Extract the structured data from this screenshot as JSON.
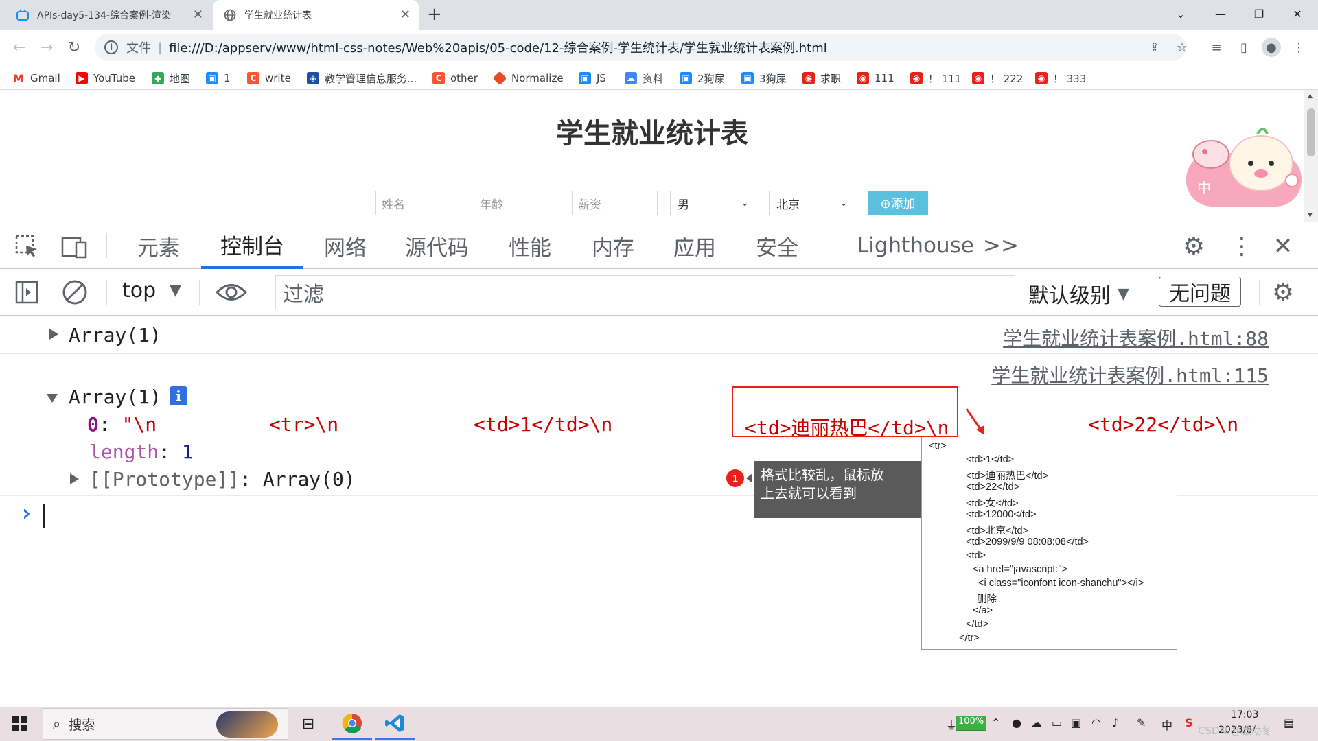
{
  "browser": {
    "tabs": [
      {
        "title": "APIs-day5-134-综合案例-渲染",
        "active": false
      },
      {
        "title": "学生就业统计表",
        "active": true
      }
    ],
    "new_tab": "+",
    "omnibox": {
      "scheme_label": "文件",
      "separator": "|",
      "url": "file:///D:/appserv/www/html-css-notes/Web%20apis/05-code/12-综合案例-学生统计表/学生就业统计表案例.html"
    },
    "bookmarks": [
      {
        "label": "Gmail",
        "icon": "gmail-icon",
        "color": "#ea4335"
      },
      {
        "label": "YouTube",
        "icon": "youtube-icon",
        "color": "#ff0000"
      },
      {
        "label": "地图",
        "icon": "maps-icon",
        "color": "#34a853"
      },
      {
        "label": "1",
        "icon": "bilibili-icon",
        "color": "#1a8cff"
      },
      {
        "label": "write",
        "icon": "csdn-icon",
        "color": "#fc5531"
      },
      {
        "label": "教学管理信息服务...",
        "icon": "school-icon",
        "color": "#1e50a2"
      },
      {
        "label": "other",
        "icon": "csdn-icon",
        "color": "#fc5531"
      },
      {
        "label": "Normalize",
        "icon": "diamond-icon",
        "color": "#e34c26"
      },
      {
        "label": "JS",
        "icon": "bilibili-icon",
        "color": "#1a8cff"
      },
      {
        "label": "资料",
        "icon": "cloud-icon",
        "color": "#4285f4"
      },
      {
        "label": "2狗屎",
        "icon": "bilibili-icon",
        "color": "#1a8cff"
      },
      {
        "label": "3狗屎",
        "icon": "bilibili-icon",
        "color": "#1a8cff"
      },
      {
        "label": "求职",
        "icon": "red-app-icon",
        "color": "#e8211b"
      },
      {
        "label": "111",
        "icon": "red-app-icon",
        "color": "#e8211b"
      },
      {
        "label": "！ 111",
        "icon": "red-app-icon",
        "color": "#e8211b"
      },
      {
        "label": "！ 222",
        "icon": "red-app-icon",
        "color": "#e8211b"
      },
      {
        "label": "！ 333",
        "icon": "red-app-icon",
        "color": "#e8211b"
      }
    ]
  },
  "page": {
    "title": "学生就业统计表",
    "name_placeholder": "姓名",
    "age_placeholder": "年龄",
    "salary_placeholder": "薪资",
    "gender_value": "男",
    "city_value": "北京",
    "add_button": "⊕添加",
    "sticker_text": "中"
  },
  "devtools": {
    "tabs": [
      "元素",
      "控制台",
      "网络",
      "源代码",
      "性能",
      "内存",
      "应用",
      "安全",
      "Lighthouse"
    ],
    "active_tab": "控制台",
    "more_tabs": ">>",
    "context": "top",
    "filter_placeholder": "过滤",
    "level": "默认级别",
    "issues": "无问题",
    "console": {
      "msg1": {
        "text": "Array(1)",
        "source": "学生就业统计表案例.html:88"
      },
      "msg2": {
        "source": "学生就业统计表案例.html:115",
        "text": "Array(1)",
        "info_badge": "i",
        "item0_key": "0",
        "item0_colon": ": ",
        "item0_quote": "\"\\n",
        "tr_open": "<tr>\\n",
        "td1": "<td>1</td>\\n",
        "td_name": "<td>迪丽热巴</td>\\n",
        "td_age": "<td>22</td>\\n",
        "length_key": "length",
        "length_val": "1",
        "proto_key": "[[Prototype]]",
        "proto_val": "Array(0)"
      },
      "prompt": "›"
    }
  },
  "annotation": {
    "badge": "1",
    "tooltip_line1": "格式比较乱，鼠标放",
    "tooltip_line2": "上去就可以看到"
  },
  "popup_lines": [
    "<tr>",
    "<td>1</td>",
    "<td>迪丽热巴</td>",
    "<td>22</td>",
    "<td>女</td>",
    "<td>12000</td>",
    "<td>北京</td>",
    "<td>2099/9/9 08:08:08</td>",
    "<td>",
    "<a href=\"javascript:\">",
    "<i class=\"iconfont icon-shanchu\"></i>",
    "删除",
    "</a>",
    "</td>",
    "</tr>"
  ],
  "taskbar": {
    "search_label": "搜索",
    "battery": "100%",
    "ime": "中",
    "time": "17:03",
    "date": "2023/8/",
    "watermark": "CSDN @激动冬"
  }
}
